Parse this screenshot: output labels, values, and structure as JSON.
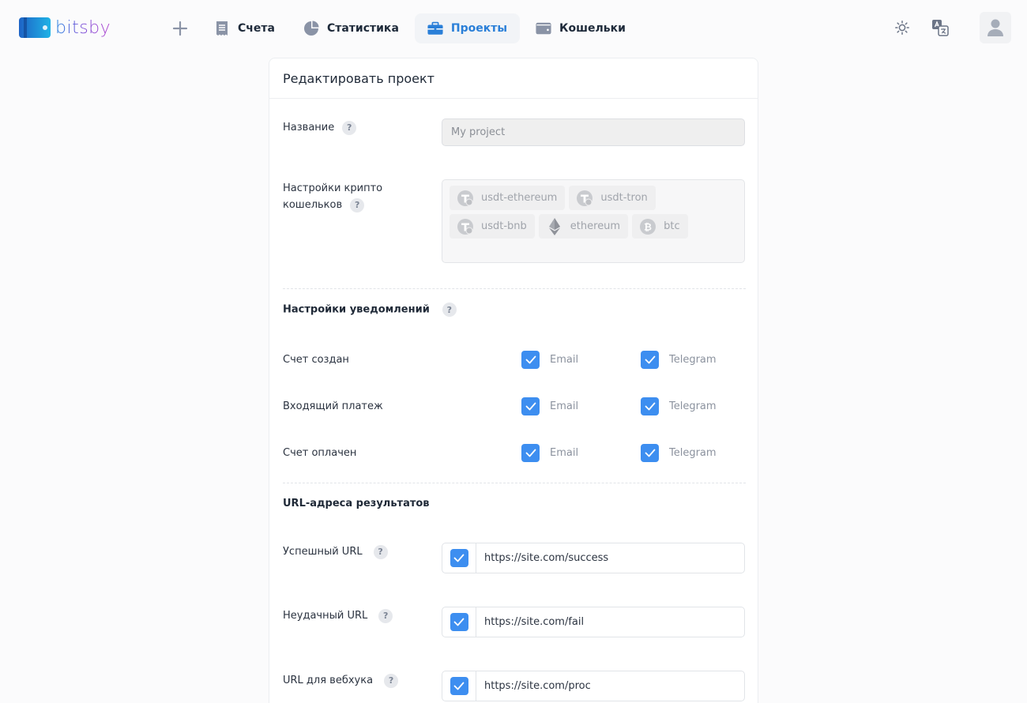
{
  "app": {
    "logo_text": "bitsby"
  },
  "nav": {
    "items": [
      {
        "label": "Счета",
        "icon": "receipt-icon",
        "active": false
      },
      {
        "label": "Статистика",
        "icon": "pie-chart-icon",
        "active": false
      },
      {
        "label": "Проекты",
        "icon": "briefcase-icon",
        "active": true
      },
      {
        "label": "Кошельки",
        "icon": "wallet-icon",
        "active": false
      }
    ]
  },
  "card": {
    "title": "Редактировать проект",
    "name_field": {
      "label": "Название",
      "value": "My project"
    },
    "crypto": {
      "label_line1": "Настройки крипто",
      "label_line2": "кошельков",
      "chips": [
        "usdt-ethereum",
        "usdt-tron",
        "usdt-bnb",
        "ethereum",
        "btc"
      ]
    },
    "notifications": {
      "title": "Настройки уведомлений",
      "rows": [
        {
          "label": "Счет создан",
          "email": "Email",
          "telegram": "Telegram"
        },
        {
          "label": "Входящий платеж",
          "email": "Email",
          "telegram": "Telegram"
        },
        {
          "label": "Счет оплачен",
          "email": "Email",
          "telegram": "Telegram"
        }
      ]
    },
    "urls": {
      "title": "URL-адреса результатов",
      "items": [
        {
          "label": "Успешный URL",
          "value": "https://site.com/success"
        },
        {
          "label": "Неудачный URL",
          "value": "https://site.com/fail"
        },
        {
          "label": "URL для вебхука",
          "value": "https://site.com/proc"
        }
      ]
    },
    "help_glyph": "?"
  },
  "colors": {
    "accent": "#3d8ef0",
    "active_nav": "#2a7fd8"
  }
}
